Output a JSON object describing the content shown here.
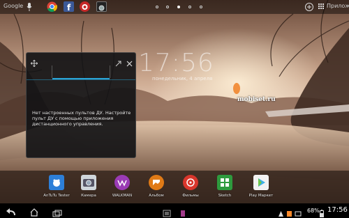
{
  "topbar": {
    "google_label": "Google",
    "apps_label": "Прилож",
    "icons": [
      "mic-icon",
      "chrome-icon",
      "facebook-icon",
      "antutu-icon",
      "camera-icon",
      "add-icon",
      "apps-grid-icon"
    ],
    "home_pages": 5,
    "active_page": 2
  },
  "clock": {
    "time": "17:56",
    "date": "понедельник, 4 апреля"
  },
  "remote_widget": {
    "message": "Нет настроенных пультов ДУ. Настройте пульт ДУ с помощью приложения дистанционного управления.",
    "icons": [
      "move-icon",
      "expand-icon",
      "close-icon"
    ]
  },
  "watermark": "mobiset.ru",
  "dock": [
    {
      "label": "AnTuTu Tester",
      "color": "#2d7fd8",
      "icon": "antutu-icon"
    },
    {
      "label": "Камера",
      "color": "#cfd6db",
      "icon": "camera-icon"
    },
    {
      "label": "WALKMAN",
      "color": "#9a3bb5",
      "icon": "walkman-icon"
    },
    {
      "label": "Альбом",
      "color": "#e07a16",
      "icon": "album-icon"
    },
    {
      "label": "Фильмы",
      "color": "#d9362c",
      "icon": "movies-icon"
    },
    {
      "label": "Sketch",
      "color": "#2e9a3e",
      "icon": "sketch-icon"
    },
    {
      "label": "Play Маркет",
      "color": "#f2f2f2",
      "icon": "play-store-icon"
    }
  ],
  "navbar": {
    "battery": "68%",
    "time": "17:56",
    "icons": [
      "back-icon",
      "home-icon",
      "recents-icon",
      "screenshot-icon",
      "menu-icon",
      "small-app-icon",
      "battery-icon",
      "notification-icon"
    ]
  },
  "colors": {
    "accent": "#2aa6d8",
    "dock_bg": "rgba(0,0,0,0.0)",
    "navbar_bg": "#000000"
  }
}
